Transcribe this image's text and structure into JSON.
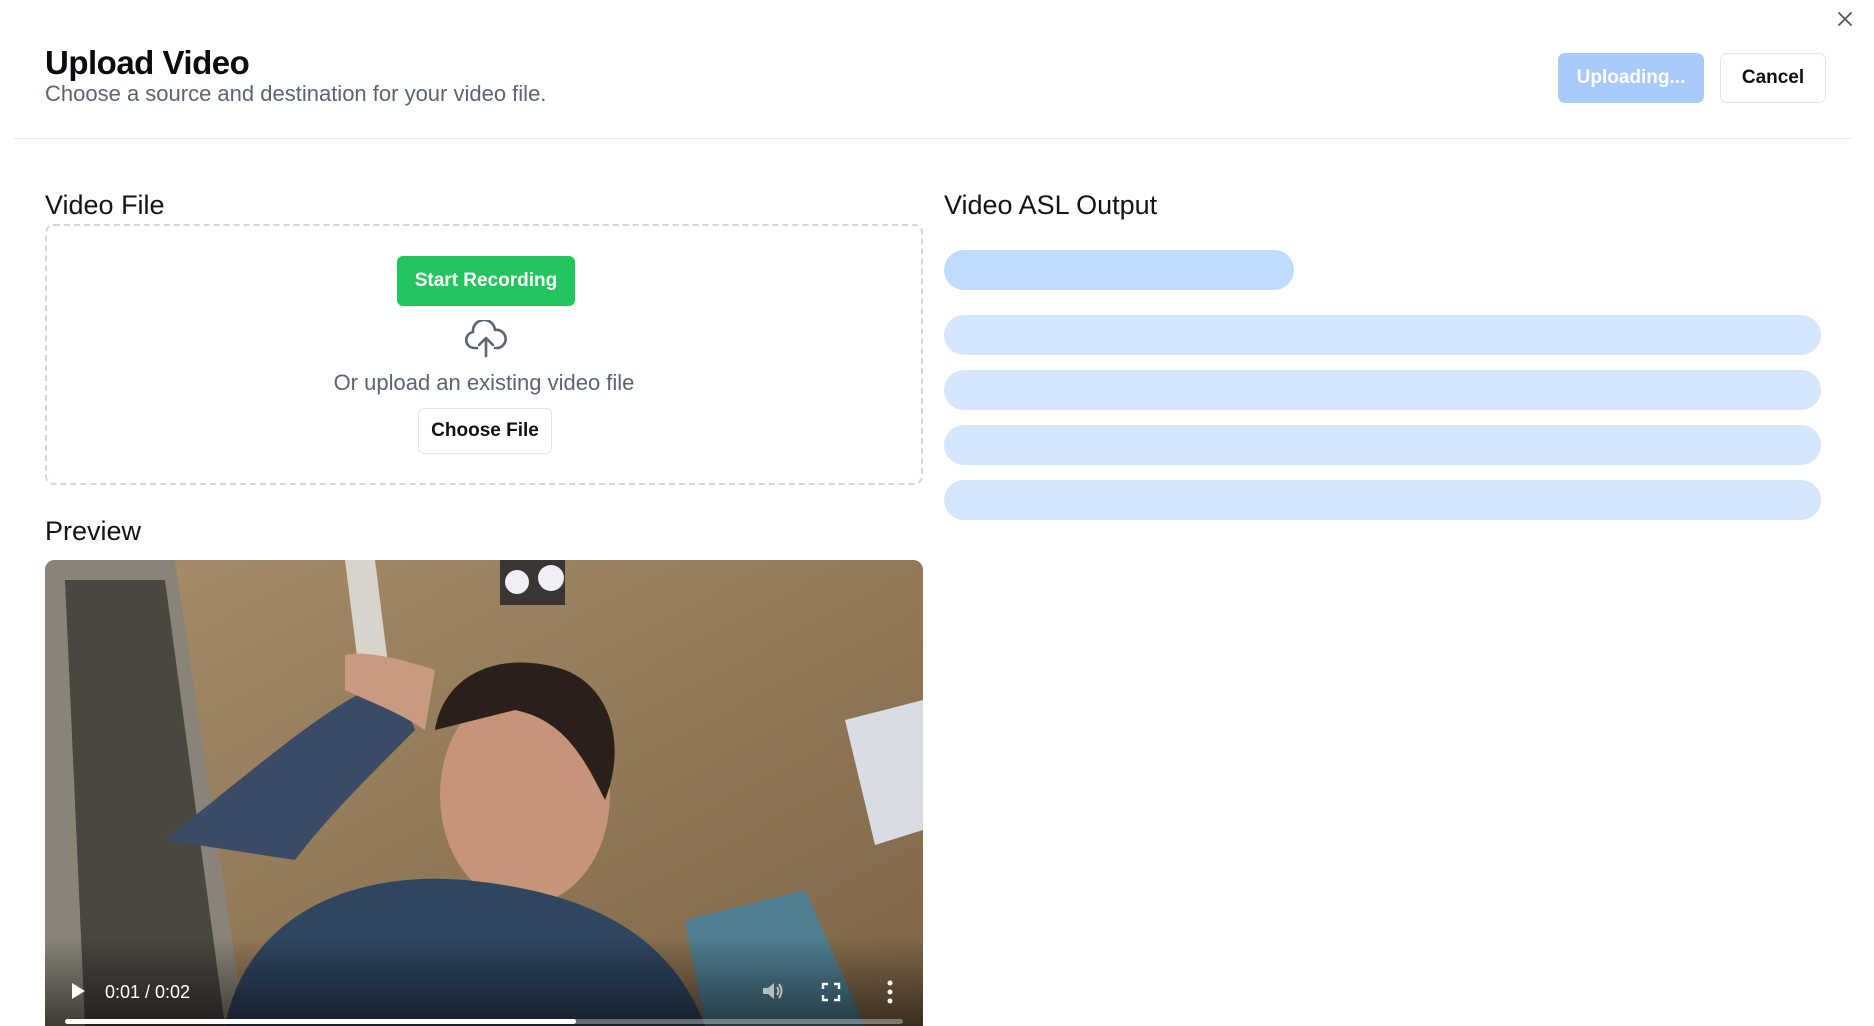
{
  "dialog": {
    "close_icon": "close-icon",
    "title": "Upload Video",
    "subtitle": "Choose a source and destination for your video file.",
    "uploading_label": "Uploading...",
    "cancel_label": "Cancel"
  },
  "video_file": {
    "title": "Video File",
    "record_label": "Start Recording",
    "upload_icon": "cloud-upload-icon",
    "upload_text": "Or upload an existing video file",
    "choose_label": "Choose File"
  },
  "preview": {
    "title": "Preview",
    "time": "0:01 / 0:02",
    "progress_fraction": 0.61,
    "icons": [
      "play-icon",
      "volume-icon",
      "fullscreen-icon",
      "more-options-icon"
    ]
  },
  "output": {
    "title": "Video ASL Output",
    "skeleton_lines": 5
  },
  "colors": {
    "primary_disabled": "#a9cbf9",
    "record_green": "#22c55e",
    "skeleton_dark": "#bfdbfe",
    "skeleton_light": "#d5e6fd"
  }
}
